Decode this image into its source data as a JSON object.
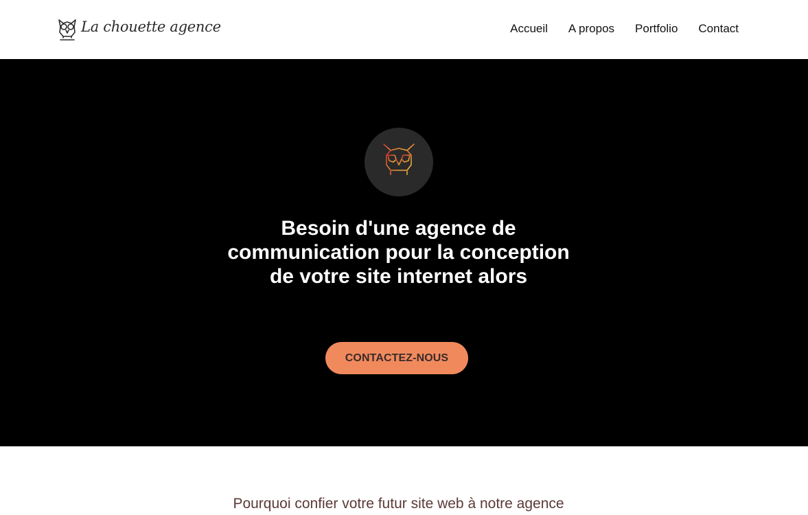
{
  "header": {
    "logo_text": "La chouette agence",
    "logo_icon": "owl-icon",
    "nav": [
      {
        "label": "Accueil"
      },
      {
        "label": "A propos"
      },
      {
        "label": "Portfolio"
      },
      {
        "label": "Contact"
      }
    ]
  },
  "hero": {
    "badge_icon": "owl-icon",
    "title": "Besoin d'une agence de communication pour la conception de votre site internet alors",
    "cta_label": "CONTACTEZ-NOUS"
  },
  "why": {
    "heading": "Pourquoi confier votre futur site web à notre agence"
  },
  "colors": {
    "hero_background": "#000000",
    "cta_background": "#f08a5d",
    "heading_color": "#5a3a36"
  }
}
